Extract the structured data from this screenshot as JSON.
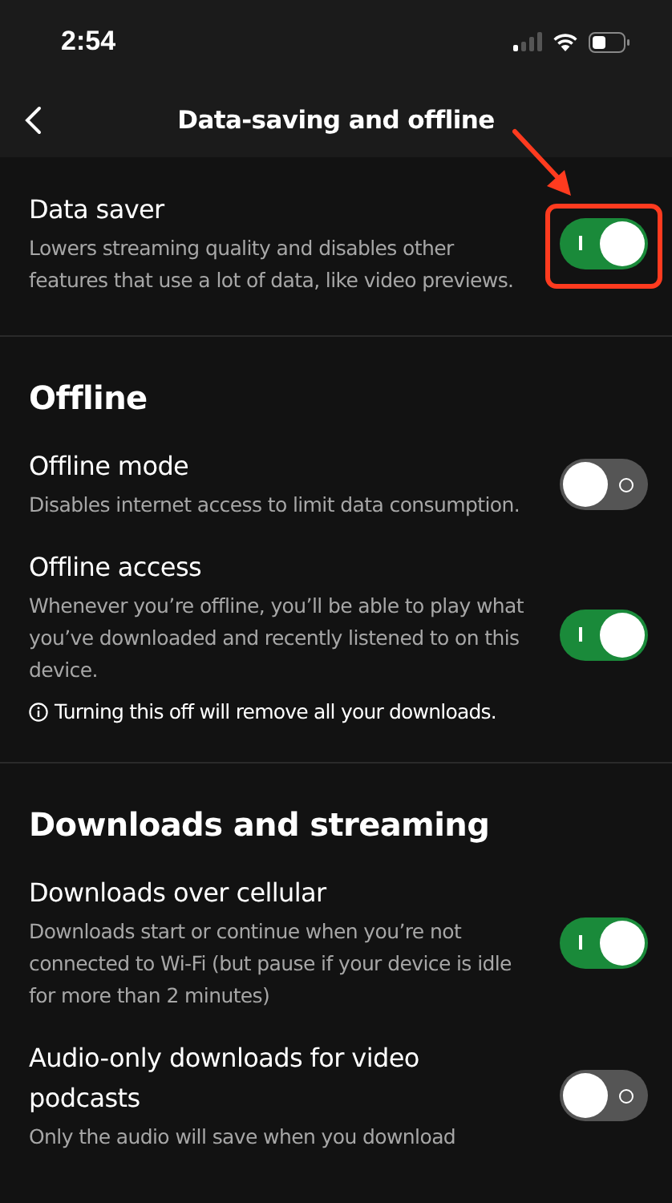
{
  "status_bar": {
    "time": "2:54"
  },
  "nav": {
    "title": "Data-saving and offline"
  },
  "sections": [
    {
      "items": [
        {
          "title": "Data saver",
          "description": "Lowers streaming quality and disables other features that use a lot of data, like video previews.",
          "on": true,
          "highlighted": true
        }
      ]
    },
    {
      "heading": "Offline",
      "items": [
        {
          "title": "Offline mode",
          "description": "Disables internet access to limit data consumption.",
          "on": false
        },
        {
          "title": "Offline access",
          "description": "Whenever you’re offline, you’ll be able to play what you’ve downloaded and recently listened to on this device.",
          "on": true,
          "note": "Turning this off will remove all your downloads."
        }
      ]
    },
    {
      "heading": "Downloads and streaming",
      "items": [
        {
          "title": "Downloads over cellular",
          "description": "Downloads start or continue when you’re not connected to Wi-Fi (but pause if your device is idle for more than 2 minutes)",
          "on": true
        },
        {
          "title": "Audio-only downloads for video podcasts",
          "description": "Only the audio will save when you download",
          "on": false
        }
      ]
    }
  ]
}
